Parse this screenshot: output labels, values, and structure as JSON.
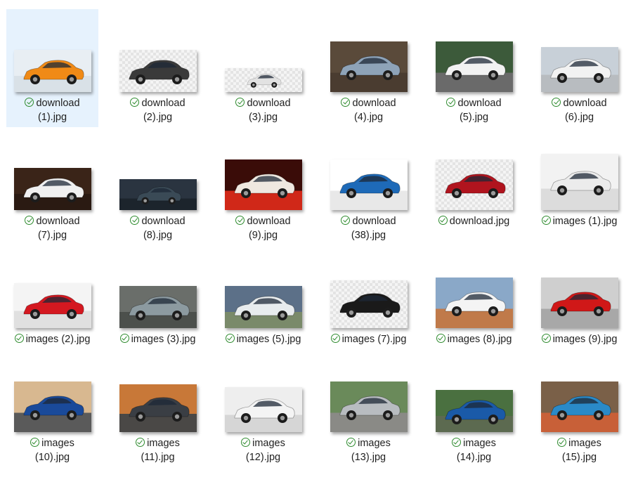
{
  "files": [
    {
      "line1": "download",
      "line2": "(1).jpg",
      "bg": "#e8eef3",
      "car": "#f08a16",
      "ground": "#d9e1e7",
      "selected": true
    },
    {
      "line1": "download",
      "line2": "(2).jpg",
      "bg": "checker",
      "car": "#3a3a3a",
      "ground": "checker"
    },
    {
      "line1": "download",
      "line2": "(3).jpg",
      "bg": "checker",
      "car": "#e2e2e2",
      "ground": "checker"
    },
    {
      "line1": "download",
      "line2": "(4).jpg",
      "bg": "#5a4a3a",
      "car": "#8ea3b8",
      "ground": "#4a3c30"
    },
    {
      "line1": "download",
      "line2": "(5).jpg",
      "bg": "#3c5a3a",
      "car": "#f2f2f2",
      "ground": "#6a6a6a"
    },
    {
      "line1": "download",
      "line2": "(6).jpg",
      "bg": "#c8d0d8",
      "car": "#f2f2f2",
      "ground": "#b8bcc0"
    },
    {
      "line1": "download",
      "line2": "(7).jpg",
      "bg": "#3a2418",
      "car": "#f0f0f0",
      "ground": "#2a1a12"
    },
    {
      "line1": "download",
      "line2": "(8).jpg",
      "bg": "#2a3440",
      "car": "#3a4a56",
      "ground": "#1c242c"
    },
    {
      "line1": "download",
      "line2": "(9).jpg",
      "bg": "#3a0c08",
      "car": "#efe8e0",
      "ground": "#d02818"
    },
    {
      "line1": "download",
      "line2": "(38).jpg",
      "bg": "#ffffff",
      "car": "#1e6ab8",
      "ground": "#e8e8e8"
    },
    {
      "line1": "download.jpg",
      "line2": "",
      "bg": "checker",
      "car": "#b0141e",
      "ground": "checker"
    },
    {
      "line1": "images (1).jpg",
      "line2": "",
      "bg": "#f2f2f2",
      "car": "#ececec",
      "ground": "#dcdcdc"
    },
    {
      "line1": "images (2).jpg",
      "line2": "",
      "bg": "#f4f4f4",
      "car": "#d41820",
      "ground": "#e0e0e0"
    },
    {
      "line1": "images (3).jpg",
      "line2": "",
      "bg": "#6a6e6a",
      "car": "#8c9aa0",
      "ground": "#4c504c"
    },
    {
      "line1": "images (5).jpg",
      "line2": "",
      "bg": "#5c7088",
      "car": "#e8ecee",
      "ground": "#7a8a6a"
    },
    {
      "line1": "images (7).jpg",
      "line2": "",
      "bg": "checker",
      "car": "#1a1a1a",
      "ground": "checker"
    },
    {
      "line1": "images (8).jpg",
      "line2": "",
      "bg": "#8aa8c8",
      "car": "#f4f4f4",
      "ground": "#c07a4a"
    },
    {
      "line1": "images (9).jpg",
      "line2": "",
      "bg": "#cfcfcf",
      "car": "#d01818",
      "ground": "#a8a8a8"
    },
    {
      "line1": "images",
      "line2": "(10).jpg",
      "bg": "#d8b890",
      "car": "#1a4a9a",
      "ground": "#5a5a5a"
    },
    {
      "line1": "images",
      "line2": "(11).jpg",
      "bg": "#c87838",
      "car": "#3a3e44",
      "ground": "#4a4846"
    },
    {
      "line1": "images",
      "line2": "(12).jpg",
      "bg": "#eeeeee",
      "car": "#f4f4f4",
      "ground": "#d6d6d6"
    },
    {
      "line1": "images",
      "line2": "(13).jpg",
      "bg": "#6a8a5a",
      "car": "#b8bcc0",
      "ground": "#8a8a86"
    },
    {
      "line1": "images",
      "line2": "(14).jpg",
      "bg": "#4a7040",
      "car": "#1a5aa8",
      "ground": "#5c6a50"
    },
    {
      "line1": "images",
      "line2": "(15).jpg",
      "bg": "#7a6048",
      "car": "#2a8ac8",
      "ground": "#c86038"
    }
  ],
  "thumb_heights": [
    60,
    60,
    34,
    72,
    72,
    64,
    60,
    44,
    72,
    72,
    72,
    80,
    64,
    60,
    60,
    68,
    72,
    72,
    72,
    68,
    64,
    72,
    60,
    72
  ]
}
